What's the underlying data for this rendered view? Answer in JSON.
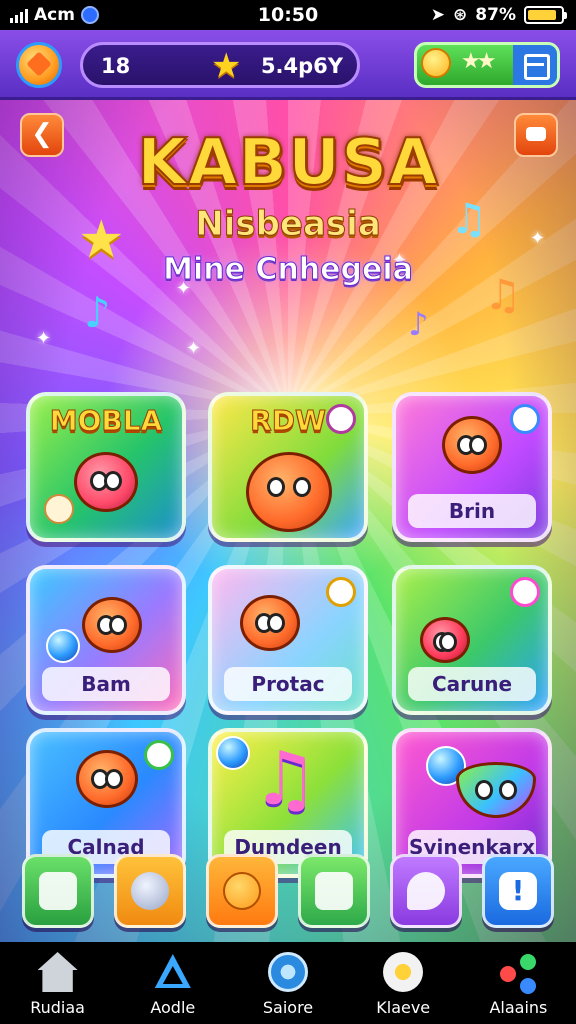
{
  "status_bar": {
    "carrier": "Acm",
    "time": "10:50",
    "battery": "87%",
    "battery_level": 0.87
  },
  "header": {
    "level": "18",
    "coins": "5.4p6Y"
  },
  "title": {
    "main": "KABUSA",
    "subtitle": "Nisbeasia",
    "tagline": "Mine Cnhegeia"
  },
  "tiles": [
    {
      "title": "MOBLA",
      "label": ""
    },
    {
      "title": "RDW",
      "label": ""
    },
    {
      "title": "",
      "label": "Brin"
    },
    {
      "title": "",
      "label": "Bam"
    },
    {
      "title": "",
      "label": "Protac"
    },
    {
      "title": "",
      "label": "Carune"
    },
    {
      "title": "",
      "label": "Calnad"
    },
    {
      "title": "",
      "label": "Dumdeen"
    },
    {
      "title": "",
      "label": "Syinenkarx"
    }
  ],
  "bottom_nav": [
    {
      "label": "Rudiaa",
      "icon": "home-icon"
    },
    {
      "label": "Aodle",
      "icon": "triangle-icon"
    },
    {
      "label": "Saiore",
      "icon": "compass-icon"
    },
    {
      "label": "Klaeve",
      "icon": "flower-icon"
    },
    {
      "label": "Alaains",
      "icon": "molecule-icon"
    }
  ],
  "colors": {
    "title_gold": "#ffd83a",
    "top_bar": "#8a4ee8",
    "accent_orange": "#ff8a3a"
  }
}
